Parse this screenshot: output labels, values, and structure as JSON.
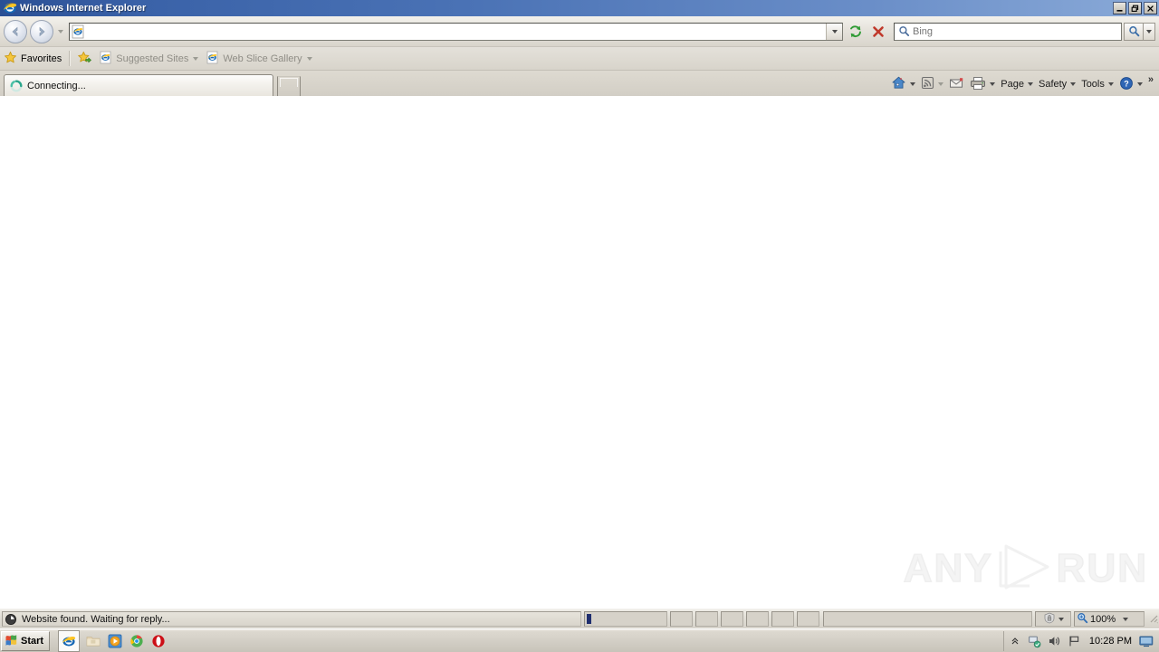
{
  "window": {
    "title": "Windows Internet Explorer",
    "icon": "ie-logo-icon",
    "minimize_label": "–",
    "restore_label": "❐",
    "close_label": "✕"
  },
  "navbar": {
    "back_icon": "back-arrow-icon",
    "forward_icon": "forward-arrow-icon",
    "history_dropdown_icon": "chevron-down-icon",
    "address": {
      "value": "",
      "placeholder": "",
      "favicon": "ie-page-icon",
      "dropdown_icon": "chevron-down-icon"
    },
    "refresh_icon": "refresh-icon",
    "stop_icon": "stop-icon",
    "search": {
      "value": "",
      "placeholder": "Bing",
      "provider": "Bing",
      "icon": "search-magnifier-icon",
      "go_icon": "search-go-icon",
      "dropdown_icon": "chevron-down-icon"
    }
  },
  "favorites_bar": {
    "favorites_label": "Favorites",
    "favorites_icon": "star-icon",
    "add_favorite_icon": "star-add-icon",
    "items": [
      {
        "label": "Suggested Sites",
        "icon": "ie-page-icon",
        "has_dropdown": true
      },
      {
        "label": "Web Slice Gallery",
        "icon": "ie-page-icon",
        "has_dropdown": true
      }
    ]
  },
  "tabs": {
    "items": [
      {
        "label": "Connecting...",
        "icon": "loading-spinner-icon",
        "active": true
      }
    ],
    "new_tab_label": ""
  },
  "command_bar": {
    "items": [
      {
        "name": "home",
        "label": "",
        "icon": "home-icon",
        "has_dropdown": true
      },
      {
        "name": "feeds",
        "label": "",
        "icon": "rss-feed-icon",
        "has_dropdown": true
      },
      {
        "name": "read-mail",
        "label": "",
        "icon": "mail-icon",
        "has_dropdown": false
      },
      {
        "name": "print",
        "label": "",
        "icon": "printer-icon",
        "has_dropdown": true
      },
      {
        "name": "page",
        "label": "Page",
        "icon": "",
        "has_dropdown": true
      },
      {
        "name": "safety",
        "label": "Safety",
        "icon": "",
        "has_dropdown": true
      },
      {
        "name": "tools",
        "label": "Tools",
        "icon": "",
        "has_dropdown": true
      },
      {
        "name": "help",
        "label": "",
        "icon": "help-icon",
        "has_dropdown": true
      }
    ],
    "overflow_label": "»"
  },
  "page": {
    "background": "#ffffff",
    "watermark": {
      "left_text": "ANY",
      "right_text": "RUN",
      "icon": "play-triangle-icon"
    }
  },
  "status_bar": {
    "message": "Website found. Waiting for reply...",
    "message_icon": "clock-icon",
    "progress_percent": 6,
    "zone": {
      "label": "",
      "icon": "security-zone-icon",
      "dropdown_icon": "chevron-down-icon"
    },
    "zoom": {
      "label": "100%",
      "icon": "zoom-magnifier-icon",
      "dropdown_icon": "chevron-down-icon"
    }
  },
  "taskbar": {
    "start_label": "Start",
    "start_icon": "windows-flag-icon",
    "quick_launch": [
      {
        "name": "internet-explorer",
        "icon": "ie-logo-icon",
        "active": true
      },
      {
        "name": "show-desktop",
        "icon": "folder-icon",
        "active": false
      },
      {
        "name": "windows-media-player",
        "icon": "media-player-icon",
        "active": false
      },
      {
        "name": "google-chrome",
        "icon": "chrome-icon",
        "active": false
      },
      {
        "name": "opera",
        "icon": "opera-icon",
        "active": false
      }
    ],
    "tray": {
      "expand_icon": "chevron-up-icon",
      "icons": [
        {
          "name": "network-icon"
        },
        {
          "name": "volume-icon"
        },
        {
          "name": "flag-icon"
        }
      ],
      "time": "10:28 PM",
      "trailing_icon": "monitor-icon"
    }
  },
  "colors": {
    "titlebar_start": "#2a4f95",
    "titlebar_end": "#8aaad8",
    "chrome_bg": "#d4d0c8",
    "progress_fill": "#1f2e6e",
    "accent_star": "#f2c33c"
  }
}
